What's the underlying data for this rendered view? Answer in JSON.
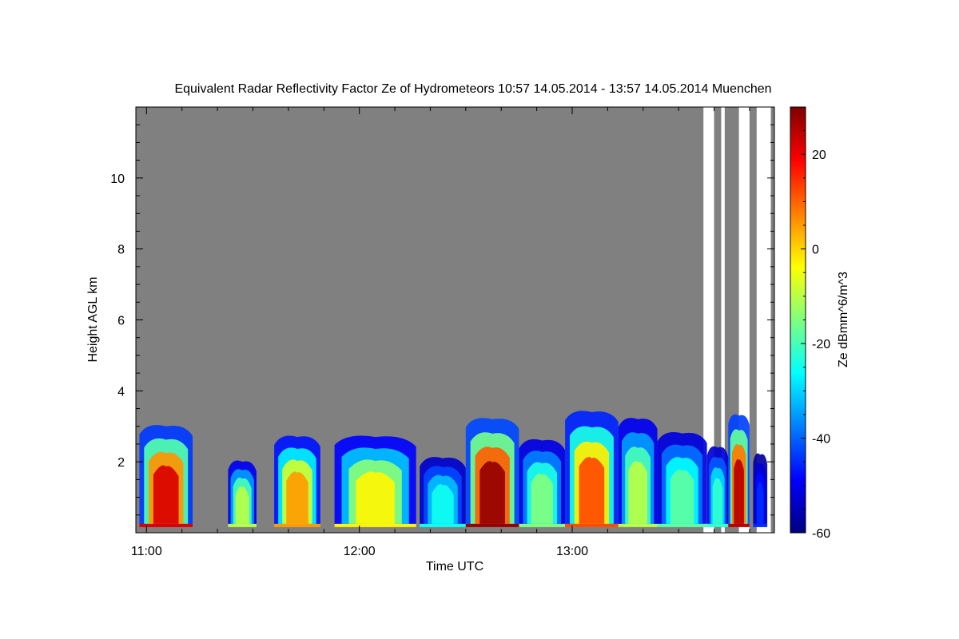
{
  "chart_data": {
    "type": "heatmap",
    "title": "Equivalent Radar Reflectivity Factor Ze of Hydrometeors   10:57 14.05.2014 - 13:57 14.05.2014 Muenchen",
    "xlabel": "Time UTC",
    "ylabel": "Height AGL km",
    "xlim": [
      "10:57",
      "13:57"
    ],
    "ylim": [
      0,
      12
    ],
    "x_ticks": [
      "11:00",
      "12:00",
      "13:00"
    ],
    "y_ticks": [
      2,
      4,
      6,
      8,
      10
    ],
    "colorbar": {
      "label": "Ze dBmm^6/m^3",
      "range": [
        -60,
        30
      ],
      "ticks": [
        20,
        0,
        -20,
        -40,
        -60
      ],
      "colormap": "jet"
    },
    "background_color": "#808080",
    "blank_color": "#ffffff",
    "echo_bands": [
      {
        "start": "10:58",
        "end": "11:13",
        "top_km": 3.0,
        "peak_dbz": 22
      },
      {
        "start": "11:23",
        "end": "11:31",
        "top_km": 2.0,
        "peak_dbz": -10
      },
      {
        "start": "11:36",
        "end": "11:49",
        "top_km": 2.7,
        "peak_dbz": 5
      },
      {
        "start": "11:53",
        "end": "12:16",
        "top_km": 2.7,
        "peak_dbz": -3
      },
      {
        "start": "12:17",
        "end": "12:30",
        "top_km": 2.1,
        "peak_dbz": -25
      },
      {
        "start": "12:30",
        "end": "12:45",
        "top_km": 3.2,
        "peak_dbz": 28
      },
      {
        "start": "12:45",
        "end": "12:58",
        "top_km": 2.6,
        "peak_dbz": -15
      },
      {
        "start": "12:58",
        "end": "13:13",
        "top_km": 3.4,
        "peak_dbz": 12
      },
      {
        "start": "13:13",
        "end": "13:24",
        "top_km": 3.2,
        "peak_dbz": -10
      },
      {
        "start": "13:24",
        "end": "13:38",
        "top_km": 2.8,
        "peak_dbz": -18
      },
      {
        "start": "13:38",
        "end": "13:44",
        "top_km": 2.4,
        "peak_dbz": -22
      },
      {
        "start": "13:44",
        "end": "13:50",
        "top_km": 3.3,
        "peak_dbz": 25
      },
      {
        "start": "13:51",
        "end": "13:55",
        "top_km": 2.2,
        "peak_dbz": -45
      }
    ],
    "blank_gaps": [
      {
        "start": "13:37",
        "end": "13:40"
      },
      {
        "start": "13:42",
        "end": "13:43"
      },
      {
        "start": "13:47",
        "end": "13:50"
      },
      {
        "start": "13:52",
        "end": "13:56"
      }
    ]
  }
}
